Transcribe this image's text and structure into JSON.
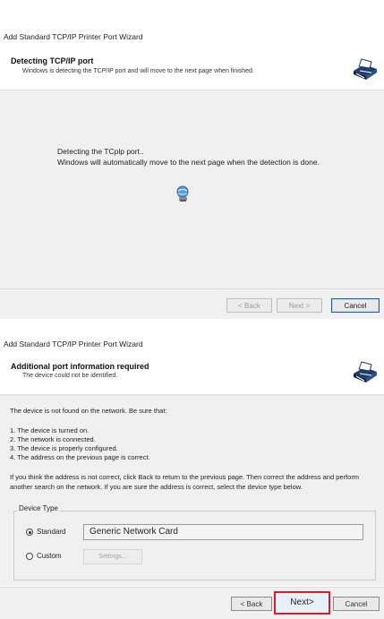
{
  "top_dialog": {
    "window_title": "Add Standard TCP/IP Printer Port Wizard",
    "header_title": "Detecting TCP/IP port",
    "header_subtitle": "Windows is detecting the TCP/IP port and will move to the next page when finished.",
    "header_icon": "printer-icon",
    "status_line1": "Detecting the TCplp port..",
    "status_line2": "Windows will automatically move to the next page when the detection is done.",
    "progress_icon": "search-globe-icon",
    "back_label": "< Back",
    "next_label": "Next >",
    "cancel_label": "Cancel"
  },
  "bottom_dialog": {
    "window_title": "Add Standard TCP/IP Printer Port Wizard",
    "header_title": "Additional port information required",
    "header_subtitle": "The device could not be identified.",
    "header_icon": "printer-icon",
    "intro": "The device is not found on the network.  Be sure that:",
    "checklist": [
      "1.  The device is turned on.",
      "2.  The network is connected.",
      "3.  The device is properly configured.",
      "4.  The address on the previous page is correct."
    ],
    "instructions": "If you think the address is not correct, click Back to return to the previous page.  Then correct the address and perform another search on the network.  If you are sure the address is correct, select the device type below.",
    "device_type_group": "Device Type",
    "standard_label": "Standard",
    "custom_label": "Custom",
    "standard_value": "Generic Network Card",
    "settings_label": "Settings...",
    "selected": "standard",
    "back_label": "< Back",
    "next_label": "Next>",
    "cancel_label": "Cancel"
  },
  "colors": {
    "body_bg": "#f0f0f0",
    "highlight_border": "#d91e2a",
    "focus_border": "#1c5aa6"
  }
}
